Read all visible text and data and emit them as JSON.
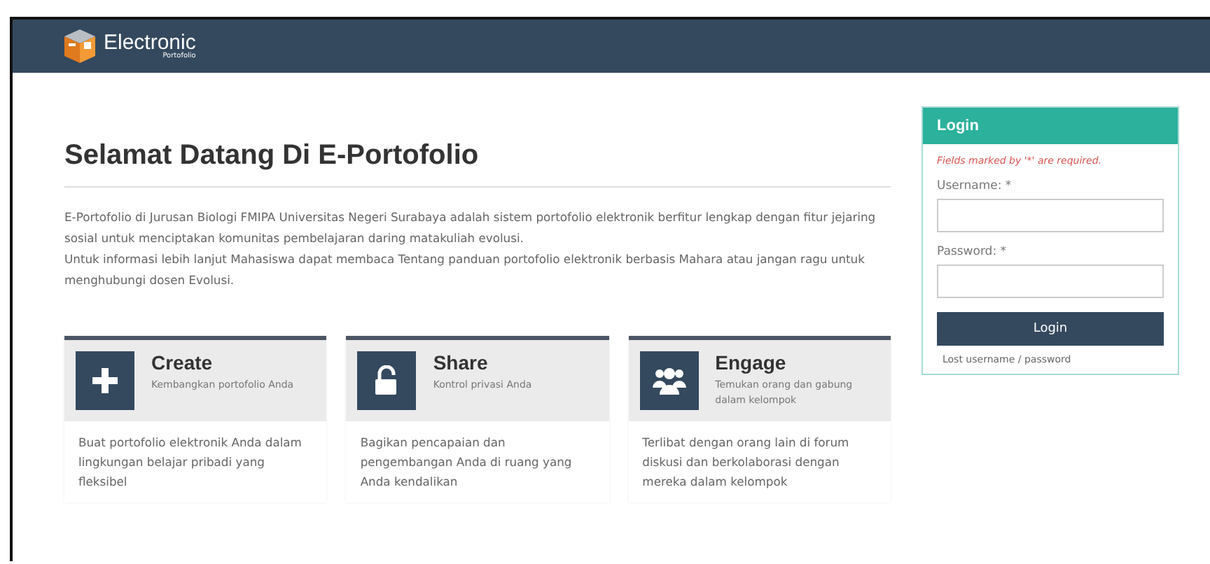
{
  "header": {
    "logo_title": "Electronic",
    "logo_subtitle": "Portofolio"
  },
  "welcome": {
    "title": "Selamat Datang Di E-Portofolio",
    "paragraphs": [
      "E-Portofolio di Jurusan Biologi FMIPA Universitas Negeri Surabaya adalah sistem portofolio elektronik berfitur lengkap dengan fitur jejaring sosial untuk menciptakan komunitas pembelajaran daring matakuliah evolusi.",
      "Untuk informasi lebih lanjut Mahasiswa dapat membaca Tentang panduan portofolio elektronik berbasis Mahara atau jangan ragu untuk menghubungi dosen Evolusi."
    ]
  },
  "cards": [
    {
      "title": "Create",
      "subtitle": "Kembangkan portofolio Anda",
      "text": "Buat portofolio elektronik Anda dalam lingkungan belajar pribadi yang fleksibel"
    },
    {
      "title": "Share",
      "subtitle": "Kontrol privasi Anda",
      "text": "Bagikan pencapaian dan pengembangan Anda di ruang yang Anda kendalikan"
    },
    {
      "title": "Engage",
      "subtitle": "Temukan orang dan gabung dalam kelompok",
      "text": "Terlibat dengan orang lain di forum diskusi dan berkolaborasi dengan mereka dalam kelompok"
    }
  ],
  "login": {
    "title": "Login",
    "required_note": "Fields marked by '*' are required.",
    "fields": [
      {
        "label": "Username: *"
      },
      {
        "label": "Password: *"
      }
    ],
    "button": "Login",
    "lost_link": "Lost username / password"
  }
}
